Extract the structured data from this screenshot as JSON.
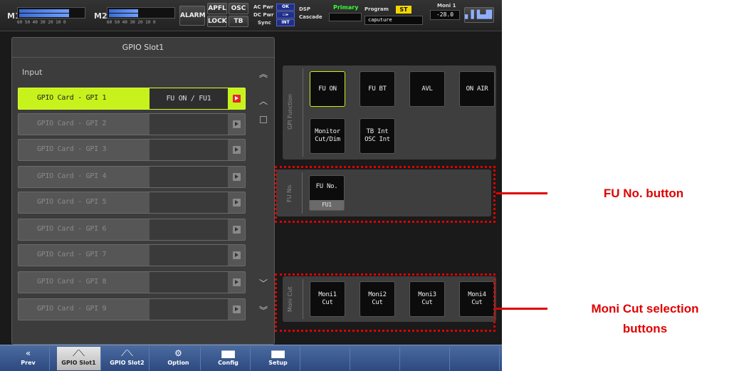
{
  "topbar": {
    "m1_label": "M1",
    "m2_label": "M2",
    "meter_scale": "60 50 40 30 20 10 0",
    "m1_level": 0.78,
    "m2_level": 0.45,
    "alarm_label": "ALARM",
    "apfl_label": "APFL",
    "osc_label": "OSC",
    "lock_label": "LOCK",
    "tb_label": "TB",
    "ac_pwr_label": "AC Pwr",
    "ac_pwr_badge": "OK",
    "dc_pwr_label": "DC Pwr",
    "sync_label": "Sync",
    "sync_badge": "INT",
    "dsp_label": "DSP",
    "primary_badge": "Primary",
    "cascade_label": "Cascade",
    "program_label": "Program",
    "program_badge": "ST",
    "program_name": "caputure",
    "moni_label": "Moni 1",
    "moni_value": "-28.0"
  },
  "left_panel": {
    "title": "GPIO Slot1",
    "section_label": "Input",
    "rows": [
      {
        "name": "GPIO Card - GPI 1",
        "assign": "FU ON / FU1",
        "active": true
      },
      {
        "name": "GPIO Card - GPI 2",
        "assign": "",
        "active": false
      },
      {
        "name": "GPIO Card - GPI 3",
        "assign": "",
        "active": false
      },
      {
        "name": "GPIO Card - GPI 4",
        "assign": "",
        "active": false
      },
      {
        "name": "GPIO Card - GPI 5",
        "assign": "",
        "active": false
      },
      {
        "name": "GPIO Card - GPI 6",
        "assign": "",
        "active": false
      },
      {
        "name": "GPIO Card - GPI 7",
        "assign": "",
        "active": false
      },
      {
        "name": "GPIO Card - GPI 8",
        "assign": "",
        "active": false
      },
      {
        "name": "GPIO Card - GPI 9",
        "assign": "",
        "active": false
      }
    ]
  },
  "gpi_function": {
    "label": "GPI Function",
    "buttons": [
      "FU ON",
      "FU BT",
      "AVL",
      "ON AIR",
      "Monitor Cut/Dim",
      "TB Int OSC Int"
    ]
  },
  "fu_no": {
    "label": "FU No.",
    "button_label": "FU No.",
    "value": "FU1"
  },
  "moni_cut": {
    "label": "Moni Cut",
    "buttons": [
      "Moni1 Cut",
      "Moni2 Cut",
      "Moni3 Cut",
      "Moni4 Cut"
    ]
  },
  "bottom_nav": [
    {
      "label": "Prev",
      "icon": "double-chevron-left-icon"
    },
    {
      "label": "GPIO Slot1",
      "icon": "gpio-icon",
      "selected": true
    },
    {
      "label": "GPIO Slot2",
      "icon": "gpio-icon"
    },
    {
      "label": "Option",
      "icon": "gears-icon"
    },
    {
      "label": "Config",
      "icon": "book-icon"
    },
    {
      "label": "Setup",
      "icon": "book-icon"
    }
  ],
  "callouts": {
    "fu_no": "FU No. button",
    "moni_cut_line1": "Moni Cut selection",
    "moni_cut_line2": "buttons"
  },
  "colors": {
    "active_row": "#c7f21c",
    "annotation_red": "#e00000",
    "nav_blue": "#3b5a90"
  }
}
